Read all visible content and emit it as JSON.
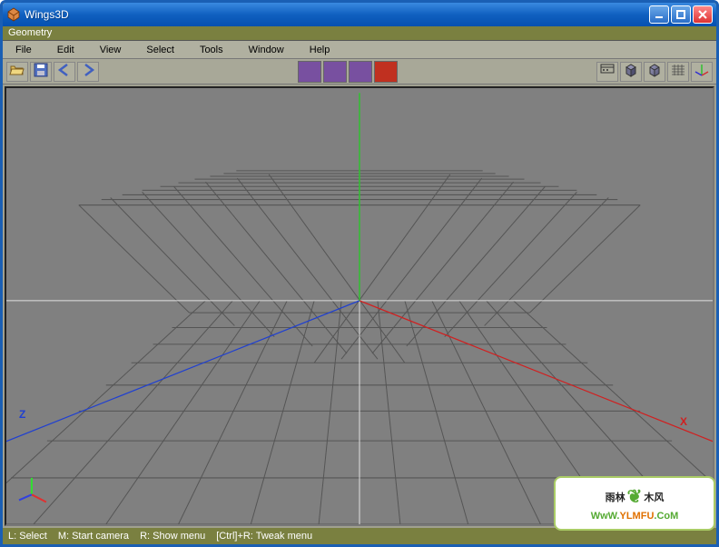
{
  "window": {
    "title": "Wings3D"
  },
  "subtitle": "Geometry",
  "menus": [
    "File",
    "Edit",
    "View",
    "Select",
    "Tools",
    "Window",
    "Help"
  ],
  "axis": {
    "x": "X",
    "z": "Z"
  },
  "status": {
    "l": "L: Select",
    "m": "M: Start camera",
    "r": "R: Show menu",
    "ctrl_r": "[Ctrl]+R: Tweak menu"
  },
  "watermark": {
    "line1_a": "雨林",
    "line1_b": "木风",
    "url": "WwW.YLMFU.CoM"
  }
}
